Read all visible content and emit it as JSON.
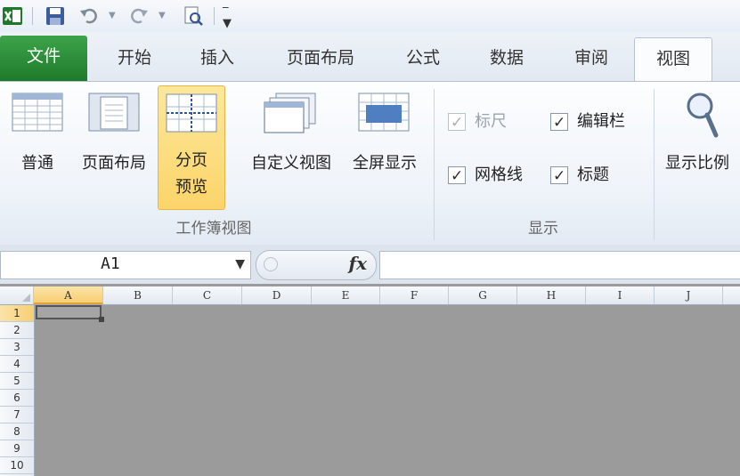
{
  "quick_access": {
    "icons": [
      "excel-icon",
      "save-icon",
      "undo-icon",
      "redo-icon",
      "print-preview-icon",
      "customize-dropdown-icon"
    ]
  },
  "tabs": [
    {
      "label": "文件",
      "active": false
    },
    {
      "label": "开始",
      "active": false
    },
    {
      "label": "插入",
      "active": false
    },
    {
      "label": "页面布局",
      "active": false
    },
    {
      "label": "公式",
      "active": false
    },
    {
      "label": "数据",
      "active": false
    },
    {
      "label": "审阅",
      "active": false
    },
    {
      "label": "视图",
      "active": true
    }
  ],
  "ribbon": {
    "workbook_views": {
      "group_label": "工作簿视图",
      "normal": "普通",
      "page_layout": "页面布局",
      "page_break_line1": "分页",
      "page_break_line2": "预览",
      "custom_views": "自定义视图",
      "full_screen": "全屏显示"
    },
    "show": {
      "group_label": "显示",
      "ruler": {
        "label": "标尺",
        "checked": true,
        "enabled": false
      },
      "formula_bar": {
        "label": "编辑栏",
        "checked": true,
        "enabled": true
      },
      "gridlines": {
        "label": "网格线",
        "checked": true,
        "enabled": true
      },
      "headings": {
        "label": "标题",
        "checked": true,
        "enabled": true
      }
    },
    "zoom": {
      "label": "显示比例"
    }
  },
  "formula_bar": {
    "name_box": "A1",
    "fx": "fx",
    "formula": ""
  },
  "sheet": {
    "columns": [
      "A",
      "B",
      "C",
      "D",
      "E",
      "F",
      "G",
      "H",
      "I",
      "J"
    ],
    "rows": [
      "1",
      "2",
      "3",
      "4",
      "5",
      "6",
      "7",
      "8",
      "9",
      "10"
    ],
    "active_column": "A",
    "active_row": "1"
  },
  "colors": {
    "file_tab": "#1e7a2a",
    "selected_button": "#fbd46a",
    "sheet_background": "#9b9b9b"
  }
}
